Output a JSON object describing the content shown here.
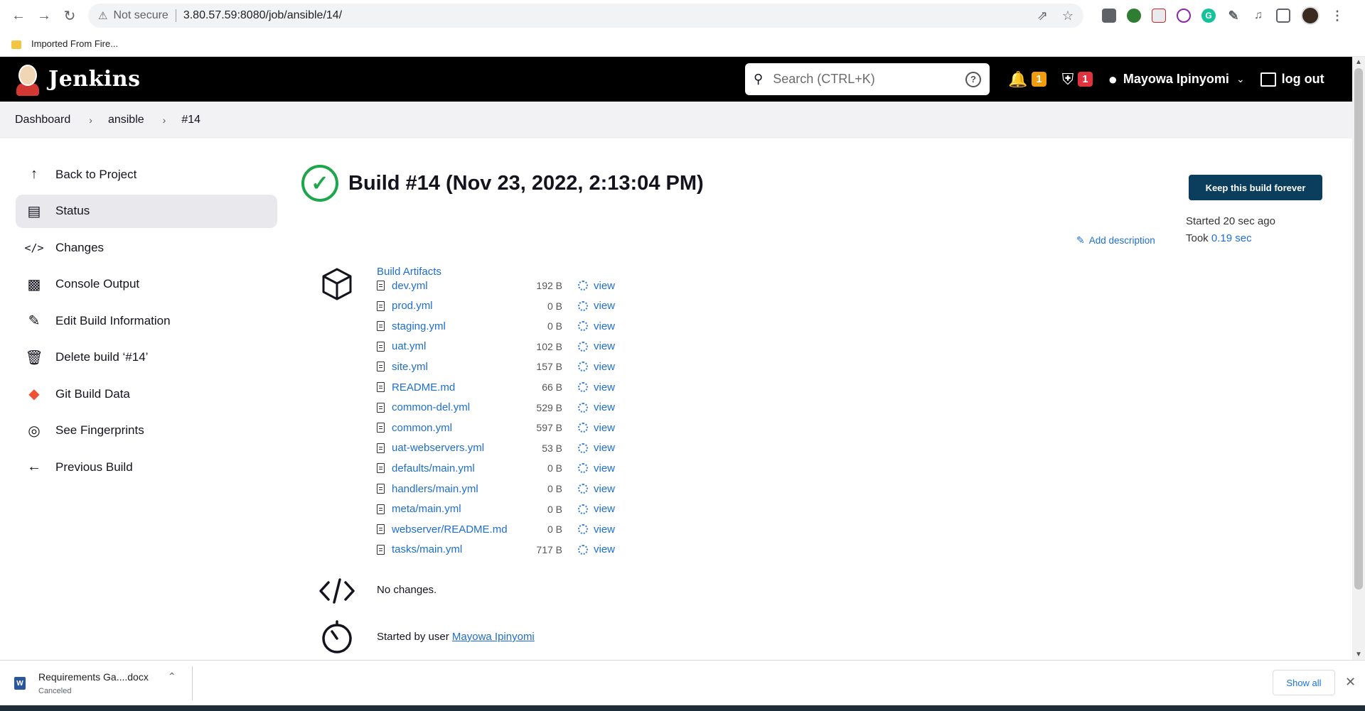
{
  "browser": {
    "security_label": "Not secure",
    "url": "3.80.57.59:8080/job/ansible/14/",
    "bookmark_label": "Imported From Fire..."
  },
  "header": {
    "brand": "Jenkins",
    "search_placeholder": "Search (CTRL+K)",
    "notifications_count": "1",
    "security_count": "1",
    "user_name": "Mayowa Ipinyomi",
    "logout_label": "log out"
  },
  "breadcrumb": {
    "items": [
      "Dashboard",
      "ansible",
      "#14"
    ]
  },
  "sidebar": {
    "items": [
      {
        "label": "Back to Project",
        "icon": "arrow-up-icon"
      },
      {
        "label": "Status",
        "icon": "document-icon"
      },
      {
        "label": "Changes",
        "icon": "code-icon"
      },
      {
        "label": "Console Output",
        "icon": "terminal-icon"
      },
      {
        "label": "Edit Build Information",
        "icon": "edit-icon"
      },
      {
        "label": "Delete build ‘#14’",
        "icon": "trash-icon"
      },
      {
        "label": "Git Build Data",
        "icon": "git-icon"
      },
      {
        "label": "See Fingerprints",
        "icon": "fingerprint-icon"
      },
      {
        "label": "Previous Build",
        "icon": "arrow-left-icon"
      }
    ]
  },
  "build": {
    "title": "Build #14 (Nov 23, 2022, 2:13:04 PM)",
    "keep_button": "Keep this build forever",
    "started_text": "Started 20 sec ago",
    "took_label": "Took",
    "took_value": "0.19 sec",
    "add_description": "Add description"
  },
  "artifacts": {
    "title": "Build Artifacts",
    "view_label": "view",
    "files": [
      {
        "name": "dev.yml",
        "size": "192 B"
      },
      {
        "name": "prod.yml",
        "size": "0 B"
      },
      {
        "name": "staging.yml",
        "size": "0 B"
      },
      {
        "name": "uat.yml",
        "size": "102 B"
      },
      {
        "name": "site.yml",
        "size": "157 B"
      },
      {
        "name": "README.md",
        "size": "66 B"
      },
      {
        "name": "common-del.yml",
        "size": "529 B"
      },
      {
        "name": "common.yml",
        "size": "597 B"
      },
      {
        "name": "uat-webservers.yml",
        "size": "53 B"
      },
      {
        "name": "defaults/main.yml",
        "size": "0 B"
      },
      {
        "name": "handlers/main.yml",
        "size": "0 B"
      },
      {
        "name": "meta/main.yml",
        "size": "0 B"
      },
      {
        "name": "webserver/README.md",
        "size": "0 B"
      },
      {
        "name": "tasks/main.yml",
        "size": "717 B"
      }
    ]
  },
  "changes_text": "No changes.",
  "started_by": {
    "prefix": "Started by user",
    "user": "Mayowa Ipinyomi"
  },
  "downloads": {
    "file_name": "Requirements Ga....docx",
    "status": "Canceled",
    "show_all": "Show all"
  },
  "colors": {
    "accent": "#1d6ed0",
    "success": "#1ea64b",
    "keep_button": "#0b3d5c",
    "header_bg": "#000000",
    "badge_warning": "#f19c0e",
    "badge_danger": "#e0333f"
  }
}
